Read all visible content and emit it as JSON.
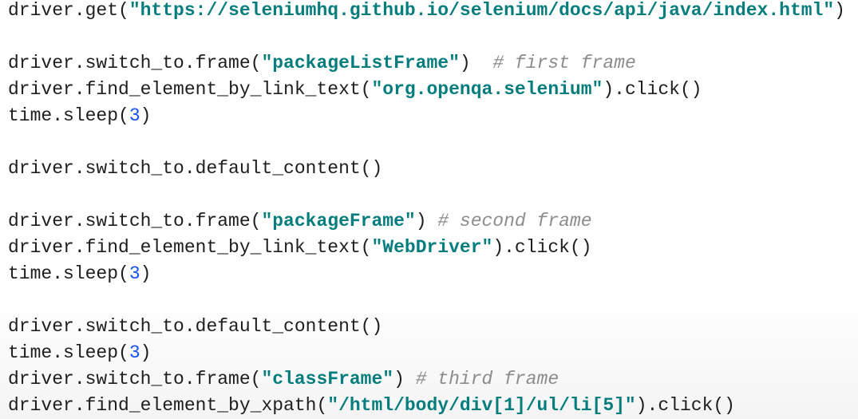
{
  "colors": {
    "string": "#067d7d",
    "number": "#1750eb",
    "comment": "#8c8c8c",
    "code": "#1e1e1e"
  },
  "lines": [
    [
      {
        "t": "code",
        "v": "driver.get("
      },
      {
        "t": "str",
        "v": "\"https://seleniumhq.github.io/selenium/docs/api/java/index.html\""
      },
      {
        "t": "code",
        "v": ")"
      }
    ],
    [],
    [
      {
        "t": "code",
        "v": "driver.switch_to.frame("
      },
      {
        "t": "str",
        "v": "\"packageListFrame\""
      },
      {
        "t": "code",
        "v": ")  "
      },
      {
        "t": "com",
        "v": "# first frame"
      }
    ],
    [
      {
        "t": "code",
        "v": "driver.find_element_by_link_text("
      },
      {
        "t": "str",
        "v": "\"org.openqa.selenium\""
      },
      {
        "t": "code",
        "v": ").click()"
      }
    ],
    [
      {
        "t": "code",
        "v": "time.sleep("
      },
      {
        "t": "num",
        "v": "3"
      },
      {
        "t": "code",
        "v": ")"
      }
    ],
    [],
    [
      {
        "t": "code",
        "v": "driver.switch_to.default_content()"
      }
    ],
    [],
    [
      {
        "t": "code",
        "v": "driver.switch_to.frame("
      },
      {
        "t": "str",
        "v": "\"packageFrame\""
      },
      {
        "t": "code",
        "v": ") "
      },
      {
        "t": "com",
        "v": "# second frame"
      }
    ],
    [
      {
        "t": "code",
        "v": "driver.find_element_by_link_text("
      },
      {
        "t": "str",
        "v": "\"WebDriver\""
      },
      {
        "t": "code",
        "v": ").click()"
      }
    ],
    [
      {
        "t": "code",
        "v": "time.sleep("
      },
      {
        "t": "num",
        "v": "3"
      },
      {
        "t": "code",
        "v": ")"
      }
    ],
    [],
    [
      {
        "t": "code",
        "v": "driver.switch_to.default_content()"
      }
    ],
    [
      {
        "t": "code",
        "v": "time.sleep("
      },
      {
        "t": "num",
        "v": "3"
      },
      {
        "t": "code",
        "v": ")"
      }
    ],
    [
      {
        "t": "code",
        "v": "driver.switch_to.frame("
      },
      {
        "t": "str",
        "v": "\"classFrame\""
      },
      {
        "t": "code",
        "v": ") "
      },
      {
        "t": "com",
        "v": "# third frame"
      }
    ],
    [
      {
        "t": "code",
        "v": "driver.find_element_by_xpath("
      },
      {
        "t": "str",
        "v": "\"/html/body/div[1]/ul/li[5]\""
      },
      {
        "t": "code",
        "v": ").click()"
      }
    ]
  ]
}
